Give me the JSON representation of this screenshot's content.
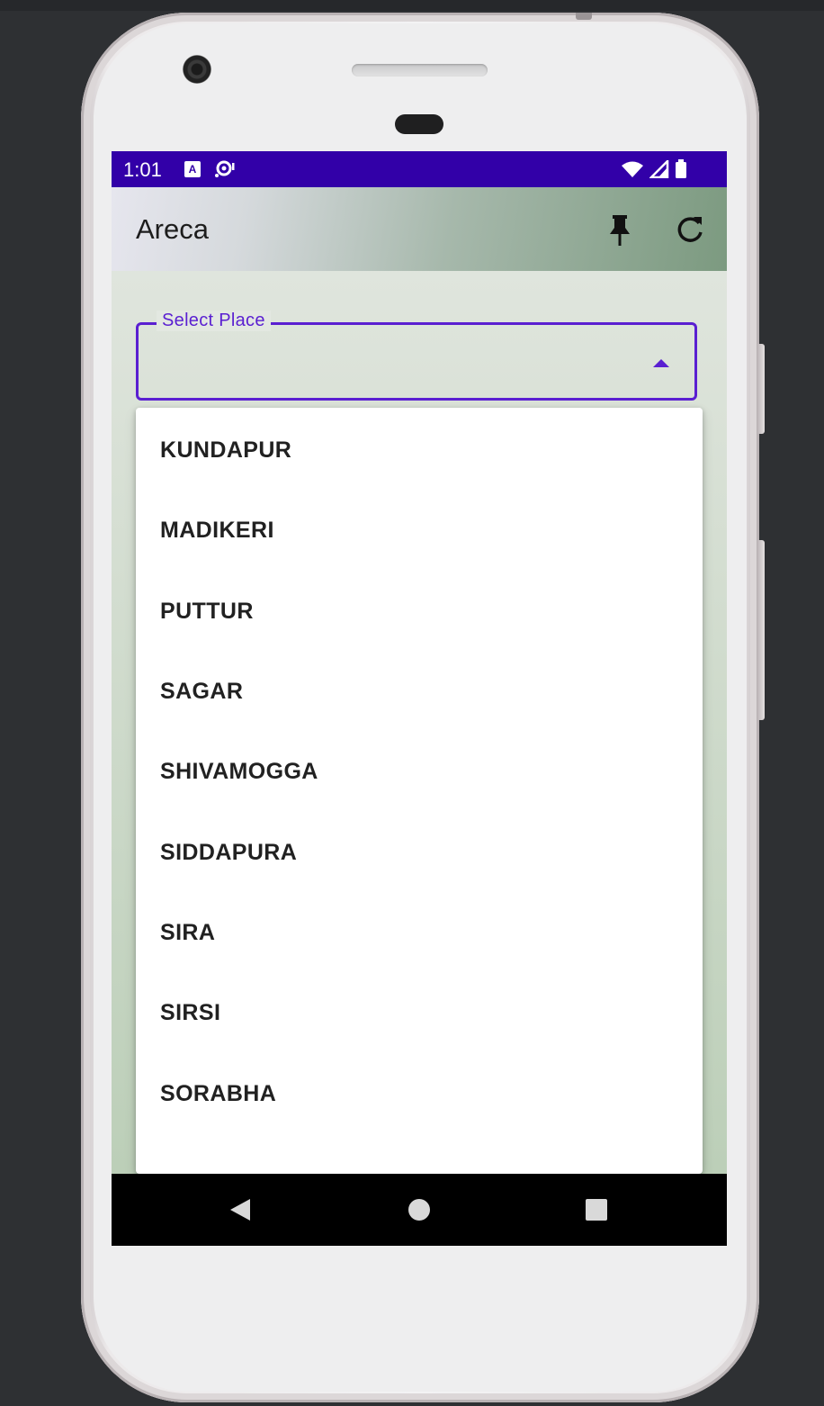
{
  "status_bar": {
    "time": "1:01",
    "icons_left": [
      "keyboard-a-icon",
      "debug-icon"
    ],
    "icons_right": [
      "wifi-icon",
      "cell-signal-icon",
      "battery-icon"
    ],
    "color": "#3200a8"
  },
  "app_bar": {
    "title": "Areca",
    "actions": [
      "pin-icon",
      "refresh-icon"
    ]
  },
  "select": {
    "label": "Select Place",
    "value": "",
    "accent": "#5a1fd1",
    "expanded": true
  },
  "dropdown": {
    "items": [
      "KUNDAPUR",
      "MADIKERI",
      "PUTTUR",
      "SAGAR",
      "SHIVAMOGGA",
      "SIDDAPURA",
      "SIRA",
      "SIRSI",
      "SORABHA"
    ]
  },
  "nav_bar": {
    "buttons": [
      "back-icon",
      "home-icon",
      "recents-icon"
    ]
  }
}
